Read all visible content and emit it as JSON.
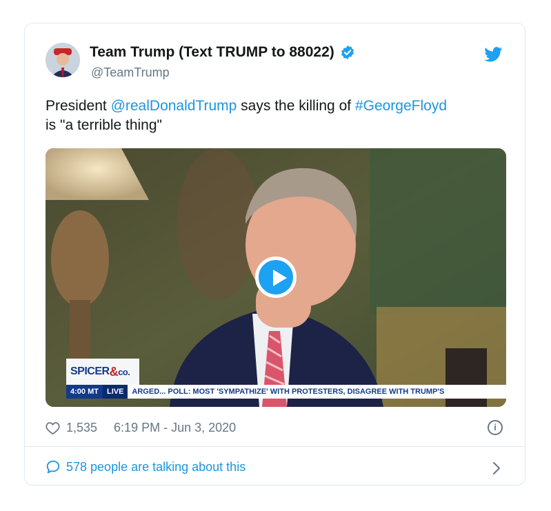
{
  "tweet": {
    "author_name": "Team Trump (Text TRUMP to 88022)",
    "handle": "@TeamTrump",
    "text_prefix": "President ",
    "mention": "@realDonaldTrump",
    "text_middle": " says the killing of ",
    "hashtag": "#GeorgeFloyd",
    "text_suffix": " is \"a terrible thing\"",
    "likes": "1,535",
    "timestamp": "6:19 PM - Jun 3, 2020",
    "talking": "578 people are talking about this"
  },
  "video": {
    "brand_primary": "SPICER",
    "brand_amp": "&",
    "brand_suffix": "co.",
    "time": "4:00 MT",
    "live": "LIVE",
    "ticker": "ARGED...    POLL: MOST 'SYMPATHIZE' WITH PROTESTERS, DISAGREE WITH TRUMP'S"
  },
  "colors": {
    "link": "#1b95e0",
    "twitter_blue": "#1da1f2",
    "text_secondary": "#657786",
    "border": "#e1e8ed"
  },
  "icons": [
    "verified-badge-icon",
    "twitter-bird-icon",
    "play-icon",
    "heart-icon",
    "info-icon",
    "speech-bubble-icon",
    "chevron-right-icon"
  ]
}
